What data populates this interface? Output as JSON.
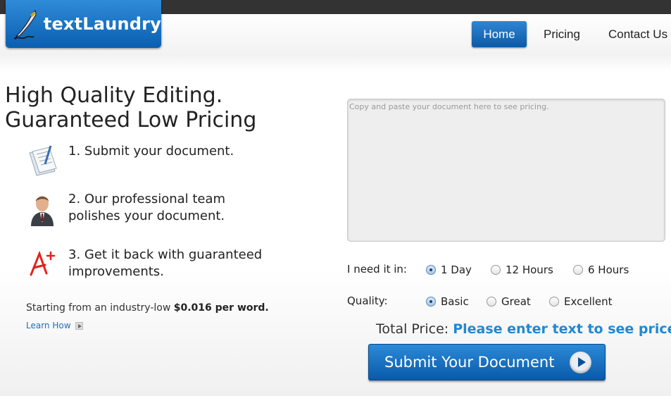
{
  "logo": {
    "name": "textLaundry"
  },
  "nav": {
    "home": "Home",
    "pricing": "Pricing",
    "contact": "Contact Us"
  },
  "headline": {
    "line1": "High Quality Editing.",
    "line2": "Guaranteed Low Pricing"
  },
  "steps": [
    {
      "line1": "1. Submit your document.",
      "line2": ""
    },
    {
      "line1": "2. Our professional team",
      "line2": "polishes your document."
    },
    {
      "line1": "3. Get it back with guaranteed",
      "line2": "improvements."
    }
  ],
  "promo": {
    "prefix": "Starting from an industry-low ",
    "price": "$0.016 per word.",
    "learn": "Learn How"
  },
  "form": {
    "doc_placeholder": "Copy and paste your document here to see pricing.",
    "doc_value": "",
    "time_label": "I need it in:",
    "time_options": [
      "1 Day",
      "12 Hours",
      "6 Hours"
    ],
    "time_selected": "1 Day",
    "quality_label": "Quality:",
    "quality_options": [
      "Basic",
      "Great",
      "Excellent"
    ],
    "quality_selected": "Basic",
    "total_label": "Total Price: ",
    "total_value": "Please enter text to see price",
    "submit_label": "Submit Your Document"
  },
  "colors": {
    "brand_blue": "#0a5fb0",
    "accent_blue": "#1e88d6",
    "topbar": "#333333"
  }
}
